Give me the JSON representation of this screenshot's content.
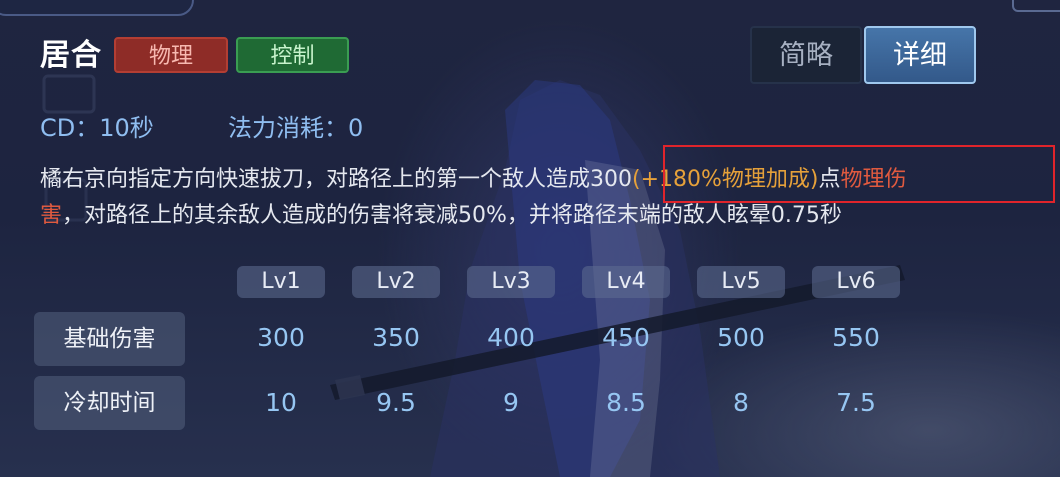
{
  "skill": {
    "name": "居合",
    "tags": [
      "物理",
      "控制"
    ]
  },
  "view_modes": {
    "brief": "简略",
    "detail": "详细",
    "selected": "详细"
  },
  "stats": {
    "cd": "CD：10秒",
    "mana": "法力消耗：0"
  },
  "description": {
    "part1": "橘右京向指定方向快速拔刀，对路径上的第一个敌人造成300",
    "bonus": "(+180%物理加成)",
    "part2": "点",
    "damage_type_a": "物理伤",
    "damage_type_b": "害",
    "part3": "，对路径上的其余敌人造成的伤害将衰减50%，并将路径末端的敌人眩晕0.75秒"
  },
  "level_table": {
    "levels": [
      "Lv1",
      "Lv2",
      "Lv3",
      "Lv4",
      "Lv5",
      "Lv6"
    ],
    "rows": [
      {
        "label": "基础伤害",
        "values": [
          "300",
          "350",
          "400",
          "450",
          "500",
          "550"
        ]
      },
      {
        "label": "冷却时间",
        "values": [
          "10",
          "9.5",
          "9",
          "8.5",
          "8",
          "7.5"
        ]
      }
    ]
  },
  "colors": {
    "physical_tag": "#8e2c27",
    "control_tag": "#1f6a34",
    "bonus_text": "#e6a13a",
    "damage_type_text": "#e05a3f",
    "stat_text": "#8fbdf0",
    "highlight_box": "#e0242b"
  }
}
